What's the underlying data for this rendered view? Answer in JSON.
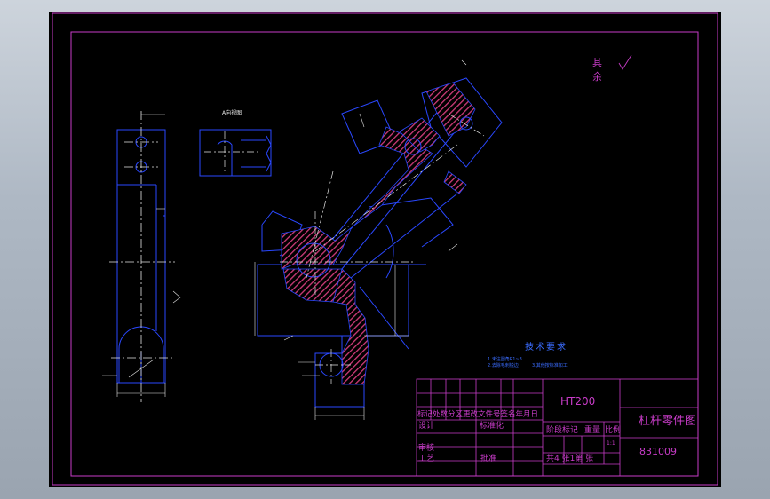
{
  "roughness": {
    "label_top": "其",
    "label_bottom": "余"
  },
  "section_label": "A向视图",
  "tech_requirements": {
    "title": "技术要求",
    "items": [
      "1.未注圆角R1~3",
      "2.去除毛刺锐边",
      "3.其他按标准加工"
    ]
  },
  "title_block": {
    "material": "HT200",
    "part_name": "杠杆零件图",
    "drawing_no": "831009",
    "revision_header": "标记处数分区更改文件号签名年月日",
    "design_label": "设计",
    "standardization_label": "标准化",
    "review_label": "审核",
    "process_label": "工艺",
    "approve_label": "批准",
    "stage_header": "阶段标记",
    "weight_header": "重量",
    "scale_header": "比例",
    "scale_value": "1:1",
    "sheets": "共4 张1第 张"
  },
  "colors": {
    "frame": "#c83cc8",
    "geometry": "#2a48ff",
    "dims": "#e6e6e6"
  }
}
